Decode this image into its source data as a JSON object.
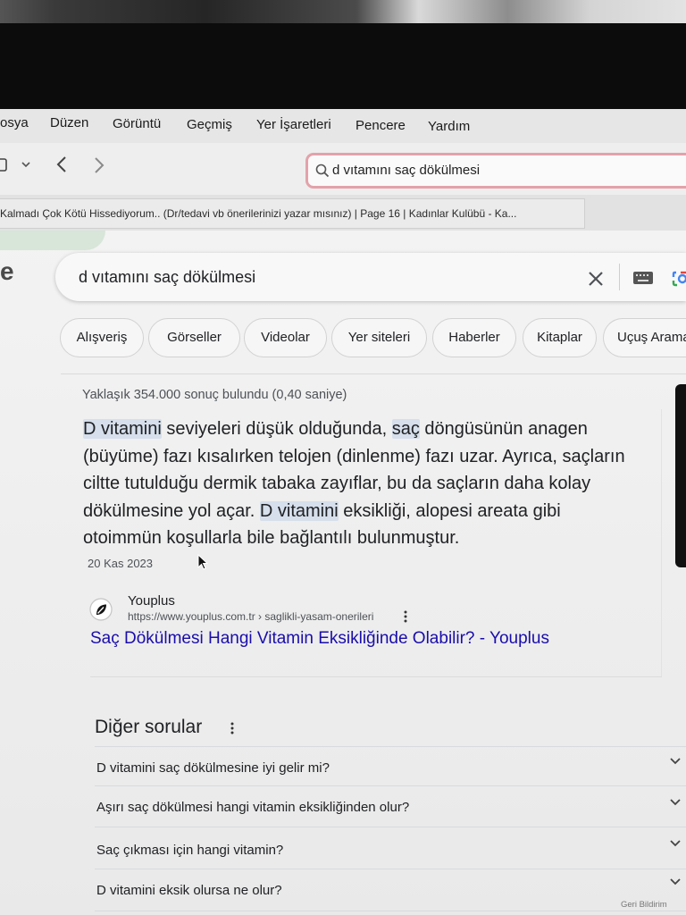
{
  "colors": {
    "link": "#1a0dab",
    "text": "#202124",
    "secondary_text": "#4d5156",
    "term_highlight": "#d6dfeb",
    "address_focus_ring": "#e3a2aa",
    "page_background": "#f1f1f1"
  },
  "browser": {
    "menu_items": [
      "osya",
      "Düzen",
      "Görüntü",
      "Geçmiş",
      "Yer İşaretleri",
      "Pencere",
      "Yardım"
    ],
    "toolbar": {
      "sidebar_icon": "sidebar-icon",
      "sidebar_menu_icon": "chevron-down-icon",
      "back_icon": "chevron-left-icon",
      "forward_icon": "chevron-right-icon"
    },
    "address_bar": {
      "icon": "search-icon",
      "value": "d vıtamını saç dökülmesi"
    },
    "tab": {
      "title": "Kalmadı Çok Kötü Hissediyorum.. (Dr/tedavi vb önerilerinizi yazar mısınız) | Page 16 | Kadınlar Kulübü - Ka..."
    }
  },
  "google": {
    "logo_fragment": "e",
    "search": {
      "value": "d vıtamını saç dökülmesi",
      "clear_icon": "close-icon",
      "keyboard_icon": "keyboard-icon",
      "lens_icon": "camera-lens-icon"
    },
    "filter_chips": [
      "Alışveriş",
      "Görseller",
      "Videolar",
      "Yer siteleri",
      "Haberler",
      "Kitaplar",
      "Uçuş Arama"
    ],
    "result_stats": "Yaklaşık 354.000 sonuç bulundu (0,40 saniye)",
    "featured_snippet": {
      "segments": [
        {
          "text": "D vitamini",
          "highlighted": true
        },
        {
          "text": " seviyeleri düşük olduğunda, ",
          "highlighted": false
        },
        {
          "text": "saç",
          "highlighted": true
        },
        {
          "text": " döngüsünün anagen (büyüme) fazı kısalırken telojen (dinlenme) fazı uzar. Ayrıca, saçların ciltte tutulduğu dermik tabaka zayıflar, bu da saçların daha kolay dökülmesine yol açar. ",
          "highlighted": false
        },
        {
          "text": "D vitamini",
          "highlighted": true
        },
        {
          "text": " eksikliği, alopesi areata gibi otoimmün koşullarla bile bağlantılı bulunmuştur.",
          "highlighted": false
        }
      ],
      "date": "20 Kas 2023",
      "source": {
        "favicon": "youplus-logo-icon",
        "name": "Youplus",
        "url": "https://www.youplus.com.tr › saglikli-yasam-onerileri",
        "more_icon": "more-vert-icon",
        "title": "Saç Dökülmesi Hangi Vitamin Eksikliğinde Olabilir? - Youplus"
      }
    },
    "people_also_ask": {
      "heading": "Diğer sorular",
      "more_icon": "more-vert-icon",
      "expand_icon": "chevron-down-icon",
      "questions": [
        "D vitamini saç dökülmesine iyi gelir mi?",
        "Aşırı saç dökülmesi hangi vitamin eksikliğinden olur?",
        "Saç çıkması için hangi vitamin?",
        "D vitamini eksik olursa ne olur?"
      ]
    },
    "feedback_link": "Geri Bildirim"
  }
}
